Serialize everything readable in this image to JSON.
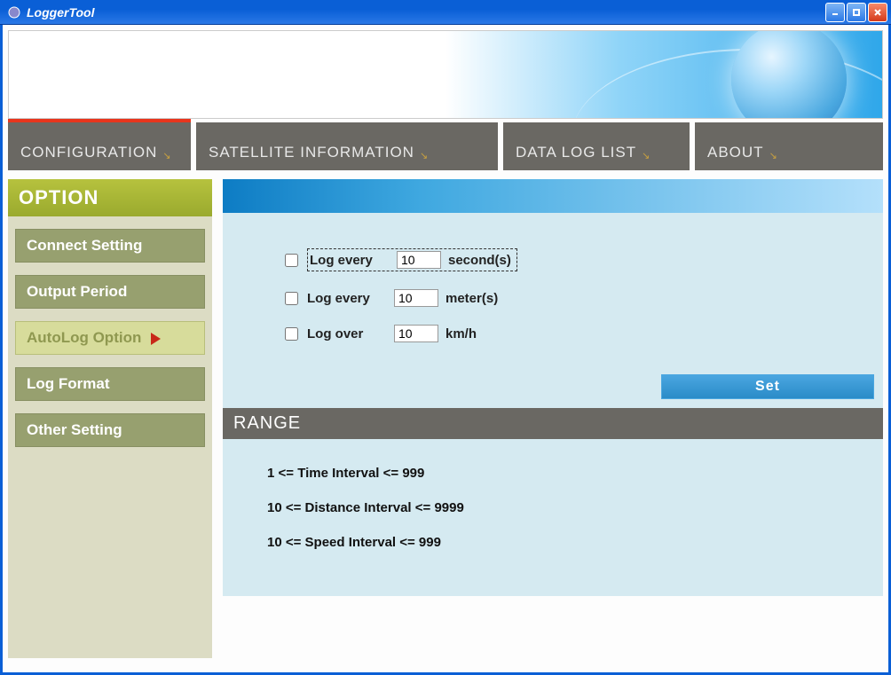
{
  "window": {
    "title": "LoggerTool"
  },
  "nav": {
    "tabs": [
      {
        "label": "CONFIGURATION"
      },
      {
        "label": "SATELLITE  INFORMATION"
      },
      {
        "label": "DATA  LOG  LIST"
      },
      {
        "label": "ABOUT"
      }
    ]
  },
  "sidebar": {
    "header": "OPTION",
    "items": [
      {
        "label": "Connect  Setting"
      },
      {
        "label": "Output  Period"
      },
      {
        "label": "AutoLog  Option"
      },
      {
        "label": "Log  Format"
      },
      {
        "label": "Other  Setting"
      }
    ]
  },
  "autolog": {
    "rows": [
      {
        "label": "Log every",
        "value": "10",
        "unit": "second(s)"
      },
      {
        "label": "Log every",
        "value": "10",
        "unit": "meter(s)"
      },
      {
        "label": "Log over",
        "value": "10",
        "unit": "km/h"
      }
    ],
    "set_button": "Set"
  },
  "range": {
    "header": "RANGE",
    "lines": [
      "1 <= Time Interval <= 999",
      "10 <= Distance Interval <= 9999",
      "10 <= Speed Interval <= 999"
    ]
  }
}
